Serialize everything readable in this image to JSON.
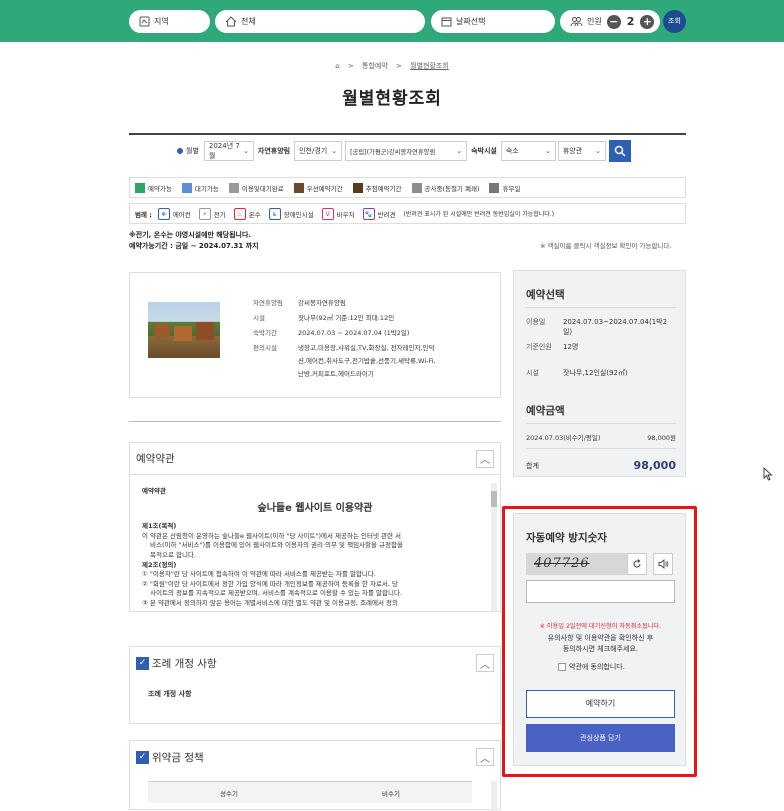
{
  "topbar": {
    "region": "지역",
    "all": "전체",
    "date": "날짜선택",
    "people_label": "인원",
    "people_count": "2",
    "query": "조회"
  },
  "breadcrumb": {
    "home": "⌂",
    "sep1": ">",
    "b1": "통합예약",
    "sep2": ">",
    "b2": "월별현황조회"
  },
  "page_title": "월별현황조회",
  "filter": {
    "monthly": "월별",
    "month": "2024년 7월",
    "forest_label": "자연휴양림",
    "region": "인천/경기",
    "forest": "[공립](가평군)강씨봉자연휴양림",
    "facility_label": "숙박시설",
    "type": "숙소",
    "subtype": "휴양관"
  },
  "legend": [
    {
      "label": "예약가능",
      "color": "#2ea36a"
    },
    {
      "label": "대기가능",
      "color": "#5b8fd6"
    },
    {
      "label": "이용및대기완료",
      "color": "#9a9a9a"
    },
    {
      "label": "우선예약기간",
      "color": "#6b4a2a"
    },
    {
      "label": "추첨예약기간",
      "color": "#5a3d1e"
    },
    {
      "label": "공사중(동절기 폐쇄)",
      "color": "#8c8c8c"
    },
    {
      "label": "휴무일",
      "color": "#777777"
    }
  ],
  "legend2": {
    "title": "범례 :",
    "items": [
      "에어컨",
      "전기",
      "온수",
      "장애인시설",
      "바우처",
      "반려견"
    ],
    "note": "(반려견 표시가 된 시설에만 반려견 동반입실이 가능합니다.)"
  },
  "notes": {
    "line1_pre": "※전기, 온수는",
    "line1_red": "야영시설에만",
    "line1_post": "해당됩니다.",
    "line2": "예약가능기간 : 금일 ~ 2024.07.31 까지",
    "right": "※ 객실이름 클릭시 객실정보 확인이 가능합니다."
  },
  "info": {
    "rows": [
      {
        "k": "자연휴양림",
        "v": "강씨봉자연휴양림"
      },
      {
        "k": "시설",
        "v": "잣나무(92㎡ 기준:12인 최대:12인"
      },
      {
        "k": "숙박기간",
        "v": "2024.07.03 ~ 2024.07.04 (1박2일)"
      },
      {
        "k": "편의시설",
        "v": "냉장고,미용장,샤워실,TV,화장실, 전자레인지,인덕션,에어컨,취사도구,전기밥솥,선풍기,세탁류,Wi-Fi,난방,커피포트,헤어드라이기"
      }
    ]
  },
  "terms": {
    "header": "예약약관",
    "sub": "예약약관",
    "title": "숲나들e 웹사이트 이용약관",
    "lines": [
      "제1조(목적)",
      "이 약관은 산림청이 운영하는 숲나들e 웹사이트(이하 \"당 사이트\")에서 제공하는 인터넷 관련 서",
      "비스(이하 \"서비스\")를 이용함에 있어 웹사이트와 이용자의 권리·의무 및 책임사항을 규정함을",
      "목적으로 합니다.",
      "제2조(정의)",
      "① \"이용자\"란 당 사이트에 접속하여 이 약관에 따라 서비스를 제공받는 자를 말합니다.",
      "② \"회원\"이란 당 사이트에서 정한 가입 양식에 따라 개인정보를 제공하여 등록을 한 자로서, 당",
      "사이트의 정보를 지속적으로 제공받으며, 서비스를 계속적으로 이용할 수 있는 자를 말합니다.",
      "③ 본 약관에서 정의하지 않은 용어는 개별서비스에 대한 별도 약관 및 이용규정, 조례에서 정의"
    ]
  },
  "ordinance": {
    "header": "조례 개정 사항",
    "sub": "조례 개정 사항"
  },
  "penalty": {
    "header": "위약금 정책",
    "col1": "성수기",
    "col2": "비수기"
  },
  "booking": {
    "title": "예약선택",
    "rows": [
      {
        "k": "이용일",
        "v": "2024.07.03~2024.07.04(1박2일)"
      },
      {
        "k": "기준인원",
        "v": "12명"
      },
      {
        "k": "시설",
        "v": "잣나무,12인실(92㎡)"
      }
    ],
    "amount_title": "예약금액",
    "amount_row_k": "2024.07.03(비수기/평일)",
    "amount_row_v": "98,000원",
    "total_k": "합계",
    "total_v": "98,000"
  },
  "captcha": {
    "title": "자동예약 방지숫자",
    "code": "407726",
    "msg_red": "※ 이용일 2일전에 대기신청이 자동취소됩니다.",
    "msg1": "유의사항 및 이용약관을 확인하신 후",
    "msg2": "동의하시면 체크해주세요.",
    "agree": "약관에 동의합니다.",
    "book": "예약하기",
    "fav": "관심상품 담기"
  }
}
